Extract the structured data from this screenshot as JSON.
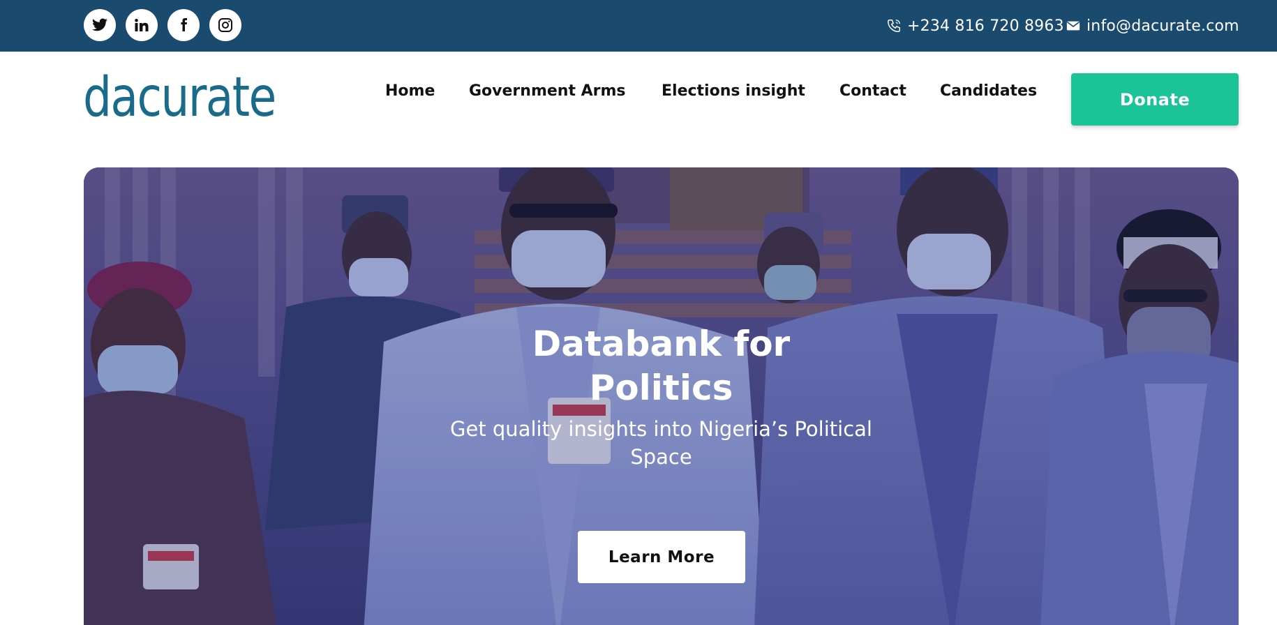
{
  "topbar": {
    "social": [
      {
        "icon": "twitter-icon",
        "label": "Twitter"
      },
      {
        "icon": "linkedin-icon",
        "label": "LinkedIn"
      },
      {
        "icon": "facebook-icon",
        "label": "Facebook"
      },
      {
        "icon": "instagram-icon",
        "label": "Instagram"
      }
    ],
    "phone": "+234 816 720 8963",
    "email": "info@dacurate.com"
  },
  "header": {
    "logo": "dacurate",
    "nav": [
      "Home",
      "Government Arms",
      "Elections insight",
      "Contact",
      "Candidates"
    ],
    "donate_label": "Donate"
  },
  "hero": {
    "title_line1": "Databank for",
    "title_line2": "Politics",
    "subtitle_line1": "Get quality insights into Nigeria’s Political",
    "subtitle_line2": "Space",
    "cta_label": "Learn More"
  },
  "colors": {
    "topbar": "#1b4a6f",
    "logo": "#1a6a8a",
    "accent": "#1bc496",
    "hero_tint": "#3b3f7a"
  }
}
